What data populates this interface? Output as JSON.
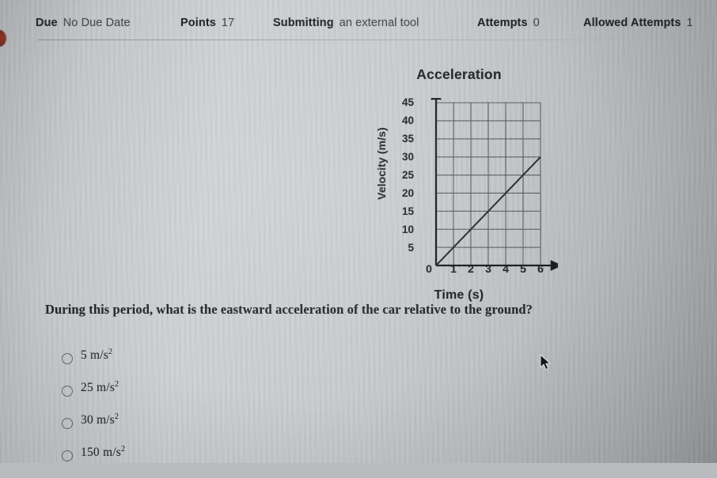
{
  "header": {
    "items": [
      {
        "key": "Due",
        "value": "No Due Date"
      },
      {
        "key": "Points",
        "value": "17"
      },
      {
        "key": "Submitting",
        "value": "an external tool"
      },
      {
        "key": "Attempts",
        "value": "0"
      },
      {
        "key": "Allowed Attempts",
        "value": "1"
      }
    ]
  },
  "chart_data": {
    "type": "line",
    "title": "Acceleration",
    "xlabel": "Time (s)",
    "ylabel": "Velocity (m/s)",
    "xlim": [
      0,
      6
    ],
    "ylim": [
      0,
      45
    ],
    "xticks": [
      "0",
      "1",
      "2",
      "3",
      "4",
      "5",
      "6"
    ],
    "yticks": [
      "5",
      "10",
      "15",
      "20",
      "25",
      "30",
      "35",
      "40",
      "45"
    ],
    "grid": true,
    "legend": "none",
    "series": [
      {
        "name": "velocity",
        "x": [
          0,
          1,
          2,
          3,
          4,
          5,
          6
        ],
        "values": [
          0,
          5,
          10,
          15,
          20,
          25,
          30
        ]
      }
    ],
    "slope": 5,
    "line_color": "#24282c"
  },
  "question": {
    "prompt": "During this period, what is the eastward acceleration of the car relative to the ground?",
    "options": [
      {
        "number": "5",
        "unit_num": "m/s",
        "unit_exp": "2",
        "selected": false
      },
      {
        "number": "25",
        "unit_num": "m/s",
        "unit_exp": "2",
        "selected": false
      },
      {
        "number": "30",
        "unit_num": "m/s",
        "unit_exp": "2",
        "selected": false
      },
      {
        "number": "150",
        "unit_num": "m/s",
        "unit_exp": "2",
        "selected": false
      }
    ]
  },
  "colors": {
    "page_background": "#c4c7c9",
    "text_primary": "#202327",
    "accent_dot": "#7a2314",
    "axis": "#1d2024",
    "gridline": "#4e5257"
  }
}
